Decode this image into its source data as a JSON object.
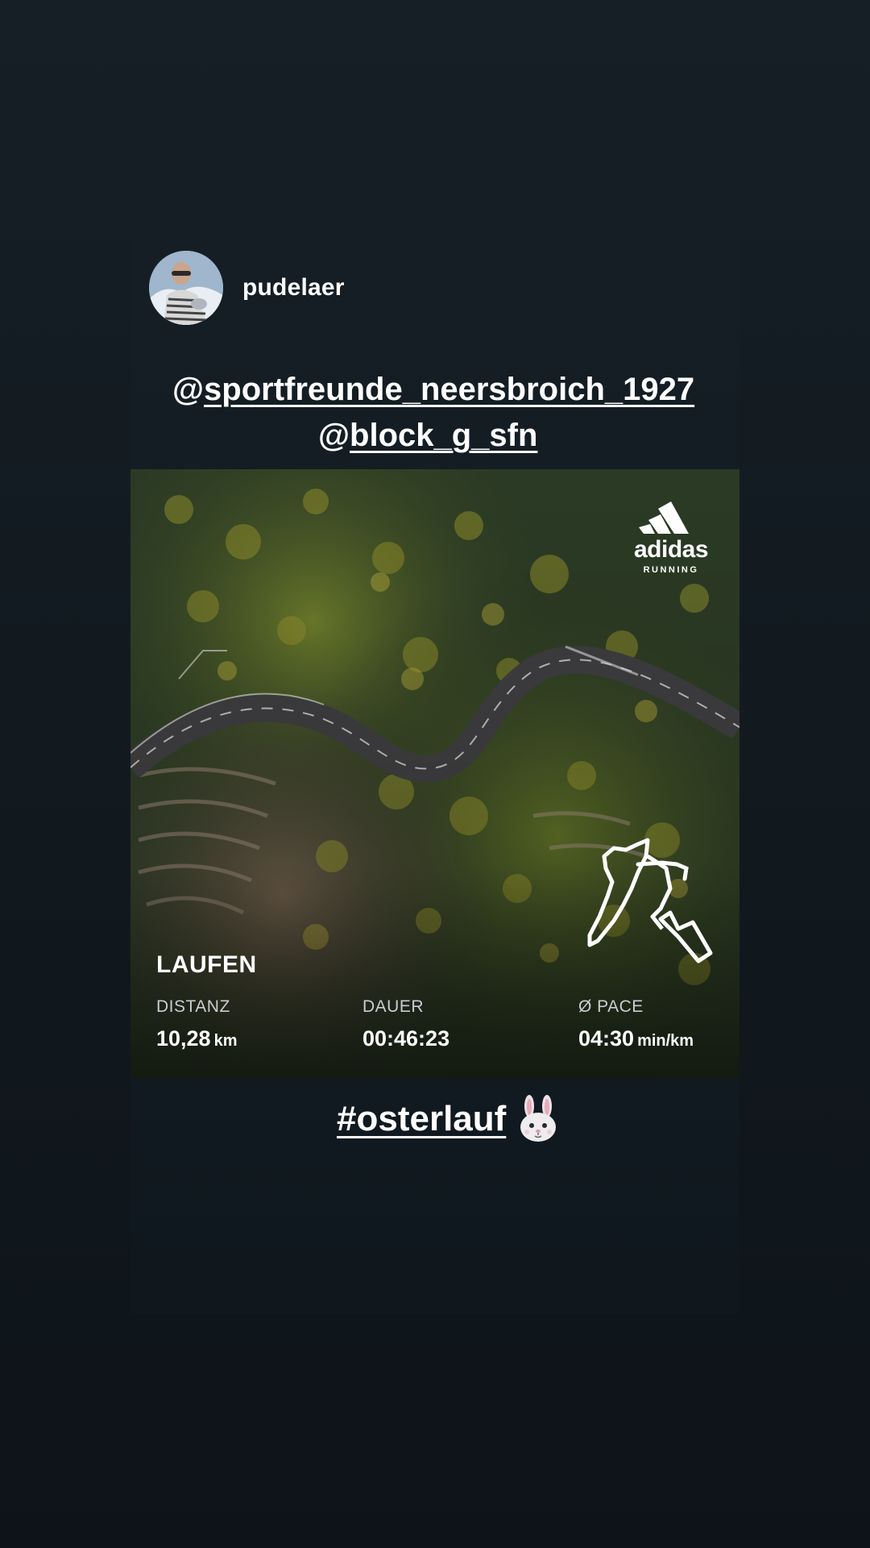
{
  "post": {
    "username": "pudelaer",
    "mentions": [
      {
        "at": "@",
        "handle": "sportfreunde_neersbroich_1927"
      },
      {
        "at": "@",
        "handle": "block_g_sfn"
      }
    ],
    "hashtag": "#osterlauf",
    "emoji_icon": "bunny-face-icon"
  },
  "activity_card": {
    "brand": {
      "name": "adidas",
      "sub": "RUNNING"
    },
    "title": "LAUFEN",
    "stats": [
      {
        "label": "DISTANZ",
        "value": "10,28",
        "unit": "km"
      },
      {
        "label": "DAUER",
        "value": "00:46:23",
        "unit": ""
      },
      {
        "label": "Ø PACE",
        "value": "04:30",
        "unit": "min/km"
      }
    ],
    "route_icon": "route-map-icon"
  },
  "colors": {
    "background": "#121a20",
    "text": "#ffffff",
    "muted_text": "#c9cdd1"
  }
}
